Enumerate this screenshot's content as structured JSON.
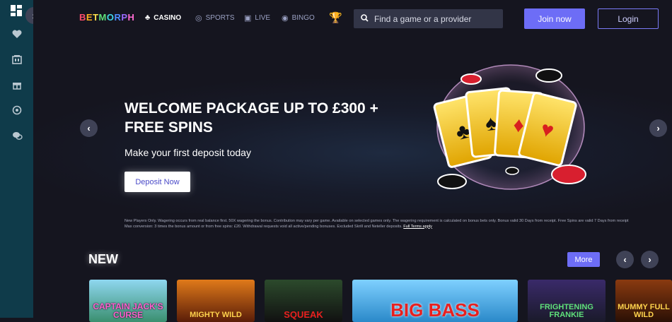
{
  "header": {
    "logo_letters": [
      "B",
      "E",
      "T",
      "M",
      "O",
      "R",
      "P",
      "H",
      ""
    ],
    "nav": [
      {
        "label": "CASINO",
        "icon": "clover-icon"
      },
      {
        "label": "SPORTS",
        "icon": "ball-icon"
      },
      {
        "label": "LIVE",
        "icon": "live-icon"
      },
      {
        "label": "BINGO",
        "icon": "bingo-icon"
      }
    ],
    "search_placeholder": "Find a game or a provider",
    "join_label": "Join now",
    "login_label": "Login"
  },
  "sidebar": {
    "items": [
      "dashboard-icon",
      "heart-icon",
      "casino-icon",
      "gift-icon",
      "target-icon",
      "chat-icon"
    ]
  },
  "banner": {
    "headline": "WELCOME PACKAGE UP TO £300 + FREE SPINS",
    "subline": "Make your first deposit today",
    "cta_label": "Deposit Now",
    "terms": "New Players Only. Wagering occurs from real balance first. 50X wagering the bonus. Contribution may vary per game. Available on selected games only. The wagering requirement is calculated on bonus bets only. Bonus valid 30 Days from receipt. Free Spins are valid 7 Days from receipt Max conversion: 3 times the bonus amount or from free spins: £20. Withdrawal requests void all active/pending bonuses. Excluded Skrill and Neteller deposits.",
    "terms_link": "Full Terms apply"
  },
  "new_section": {
    "title": "NEW",
    "more_label": "More",
    "games": [
      {
        "name": "CAPTAIN JACK'S CURSE"
      },
      {
        "name": "MIGHTY WILD"
      },
      {
        "name": "SQUEAK"
      },
      {
        "name": "BIG BASS"
      },
      {
        "name": "FRIGHTENING FRANKIE"
      },
      {
        "name": "MUMMY FULL WILD"
      }
    ]
  },
  "colors": {
    "accent": "#6d6df6",
    "sidebar": "#0f3b4a",
    "background": "#15151f"
  }
}
